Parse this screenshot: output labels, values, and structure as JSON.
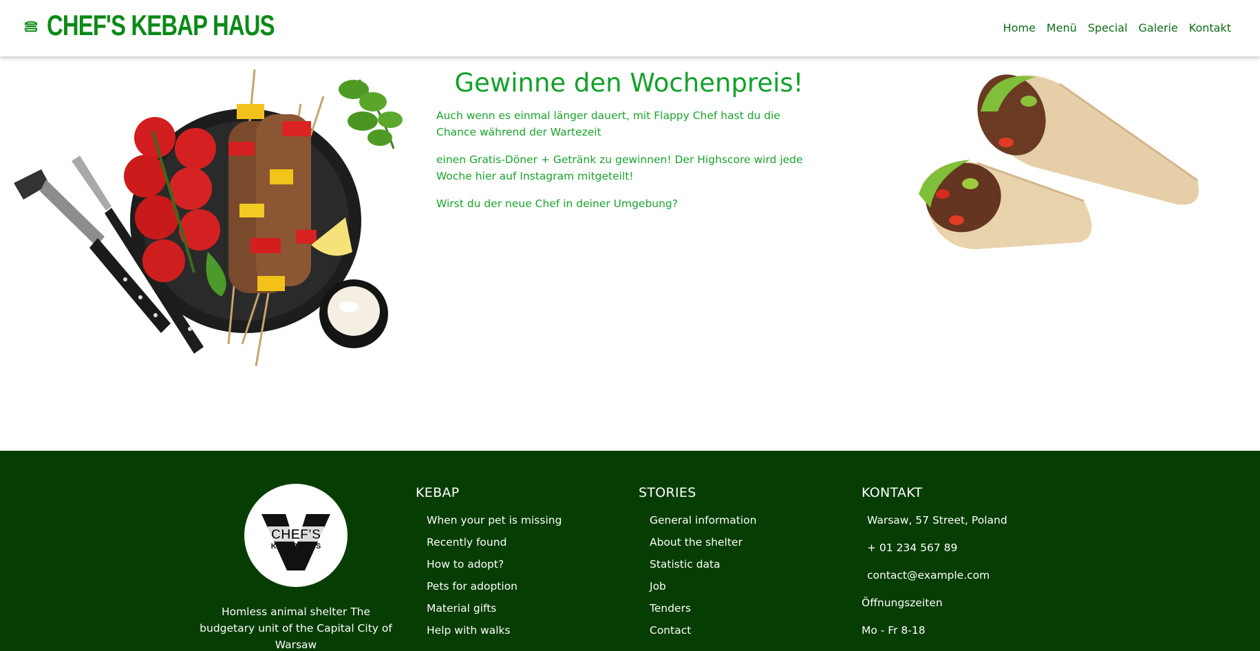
{
  "header": {
    "brand": "CHEF'S KEBAP HAUS",
    "brand_icon": "burger-icon",
    "nav": [
      "Home",
      "Menü",
      "Special",
      "Galerie",
      "Kontakt"
    ]
  },
  "promo": {
    "title": "Gewinne den Wochenpreis!",
    "paragraphs": [
      "Auch wenn es einmal länger dauert, mit Flappy Chef hast du die Chance während der Wartezeit",
      "einen Gratis-Döner + Getränk zu gewinnen! Der Highscore wird jede Woche hier auf Instagram mitgeteilt!",
      "Wirst du der neue Chef in deiner Umgebung?"
    ]
  },
  "footer": {
    "logo": {
      "line1": "CHEF'S",
      "line2": "KEBAP HAUS"
    },
    "about": "Homless animal shelter The budgetary unit of the Capital City of Warsaw",
    "kebap": {
      "heading": "KEBAP",
      "items": [
        "When your pet is missing",
        "Recently found",
        "How to adopt?",
        "Pets for adoption",
        "Material gifts",
        "Help with walks"
      ]
    },
    "stories": {
      "heading": "STORIES",
      "items": [
        "General information",
        "About the shelter",
        "Statistic data",
        "Job",
        "Tenders",
        "Contact"
      ]
    },
    "kontakt": {
      "heading": "KONTAKT",
      "address": "Warsaw, 57 Street, Poland",
      "phone": "+ 01 234 567 89",
      "email": "contact@example.com",
      "hours_label": "Öffnungszeiten",
      "hours": "Mo - Fr 8-18"
    }
  },
  "colors": {
    "brand_green": "#0a8a16",
    "text_green": "#1aa22c",
    "footer_bg": "#063d02",
    "nav_green": "#0d6b16"
  }
}
